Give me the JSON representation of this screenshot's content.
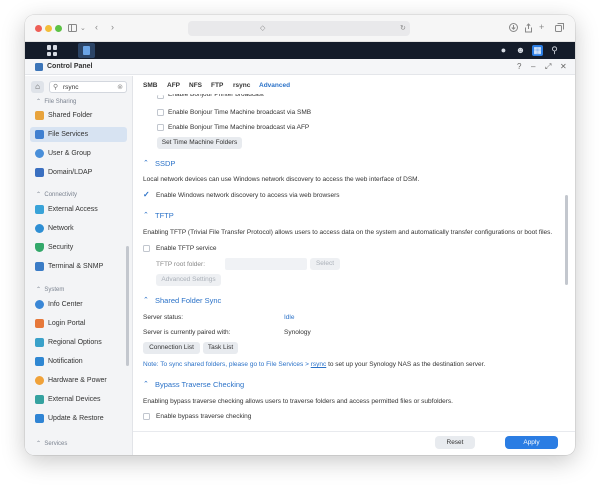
{
  "window": {
    "title": "Control Panel"
  },
  "header_icons": {
    "help": "?",
    "minimize": "–",
    "maximize": "⤢",
    "close": "✕"
  },
  "search": {
    "value": "rsync",
    "icon": "search-icon",
    "clear": "clear-icon"
  },
  "sidebar": {
    "sections": [
      {
        "label": "File Sharing"
      },
      {
        "label": "Connectivity"
      },
      {
        "label": "System"
      },
      {
        "label": "Services"
      }
    ],
    "items": [
      {
        "label": "Shared Folder",
        "icon": "shared-folder-icon",
        "color": "#e8a33c"
      },
      {
        "label": "File Services",
        "icon": "file-services-icon",
        "color": "#3f7fd0",
        "active": true
      },
      {
        "label": "User & Group",
        "icon": "user-group-icon",
        "color": "#4a8fd9"
      },
      {
        "label": "Domain/LDAP",
        "icon": "domain-icon",
        "color": "#3a6fc0"
      },
      {
        "label": "External Access",
        "icon": "external-access-icon",
        "color": "#39a3d8"
      },
      {
        "label": "Network",
        "icon": "network-icon",
        "color": "#2f8fd4"
      },
      {
        "label": "Security",
        "icon": "security-icon",
        "color": "#33a86a"
      },
      {
        "label": "Terminal & SNMP",
        "icon": "terminal-icon",
        "color": "#3b7cc6"
      },
      {
        "label": "Info Center",
        "icon": "info-icon",
        "color": "#3a87d6"
      },
      {
        "label": "Login Portal",
        "icon": "login-portal-icon",
        "color": "#e6783a"
      },
      {
        "label": "Regional Options",
        "icon": "regional-icon",
        "color": "#3aa1c9"
      },
      {
        "label": "Notification",
        "icon": "notification-icon",
        "color": "#2f87d2"
      },
      {
        "label": "Hardware & Power",
        "icon": "hardware-power-icon",
        "color": "#f0a23a"
      },
      {
        "label": "External Devices",
        "icon": "external-devices-icon",
        "color": "#35a2a0"
      },
      {
        "label": "Update & Restore",
        "icon": "update-restore-icon",
        "color": "#2f84d4"
      }
    ]
  },
  "tabs": [
    "SMB",
    "AFP",
    "NFS",
    "FTP",
    "rsync",
    "Advanced"
  ],
  "active_tab": "Advanced",
  "bonjour": {
    "printer_partial": "Enable Bonjour Printer broadcast",
    "tm_smb": "Enable Bonjour Time Machine broadcast via SMB",
    "tm_afp": "Enable Bonjour Time Machine broadcast via AFP",
    "set_tm_button": "Set Time Machine Folders"
  },
  "ssdp": {
    "title": "SSDP",
    "description": "Local network devices can use Windows network discovery to access the web interface of DSM.",
    "checkbox": "Enable Windows network discovery to access via web browsers",
    "checked": true
  },
  "tftp": {
    "title": "TFTP",
    "description": "Enabling TFTP (Trivial File Transfer Protocol) allows users to access data on the system and automatically transfer configurations or boot files.",
    "checkbox": "Enable TFTP service",
    "root_label": "TFTP root folder:",
    "select_button": "Select",
    "advanced_button": "Advanced Settings"
  },
  "shared_sync": {
    "title": "Shared Folder Sync",
    "status_label": "Server status:",
    "status_value": "Idle",
    "paired_label": "Server is currently paired with:",
    "paired_value": "Synology",
    "connection_button": "Connection List",
    "task_button": "Task List",
    "note_prefix": "Note:  To sync shared folders, please go to File Services >",
    "note_link": "rsync",
    "note_suffix": "to set up your Synology NAS as the destination server."
  },
  "bypass": {
    "title": "Bypass Traverse Checking",
    "description": "Enabling bypass traverse checking allows users to traverse folders and access permitted files or subfolders.",
    "checkbox": "Enable bypass traverse checking"
  },
  "footer": {
    "reset": "Reset",
    "apply": "Apply"
  },
  "colors": {
    "accent": "#2b72c8",
    "apply": "#2b7de3"
  }
}
